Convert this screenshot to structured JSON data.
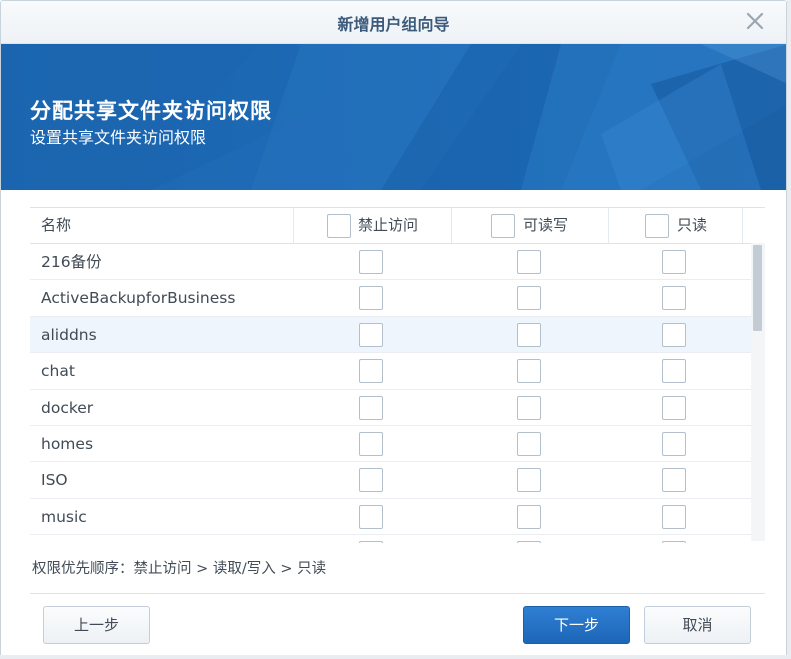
{
  "window": {
    "title": "新增用户组向导",
    "close_icon": "close-icon"
  },
  "banner": {
    "heading": "分配共享文件夹访问权限",
    "subheading": "设置共享文件夹访问权限",
    "color": "#1f6ab4"
  },
  "table": {
    "columns": {
      "name": "名称",
      "deny": "禁止访问",
      "read_write": "可读写",
      "read_only": "只读"
    },
    "rows": [
      {
        "name": "216备份"
      },
      {
        "name": "ActiveBackupforBusiness"
      },
      {
        "name": "aliddns"
      },
      {
        "name": "chat"
      },
      {
        "name": "docker"
      },
      {
        "name": "homes"
      },
      {
        "name": "ISO"
      },
      {
        "name": "music"
      },
      {
        "name": ""
      }
    ],
    "selected_row_index": 2
  },
  "hint": "权限优先顺序：禁止访问 > 读取/写入 > 只读",
  "buttons": {
    "prev": "上一步",
    "next": "下一步",
    "cancel": "取消"
  },
  "colors": {
    "accent": "#1d66b8",
    "title_text": "#3c5b7c",
    "selected_row": "#eef5fd"
  }
}
